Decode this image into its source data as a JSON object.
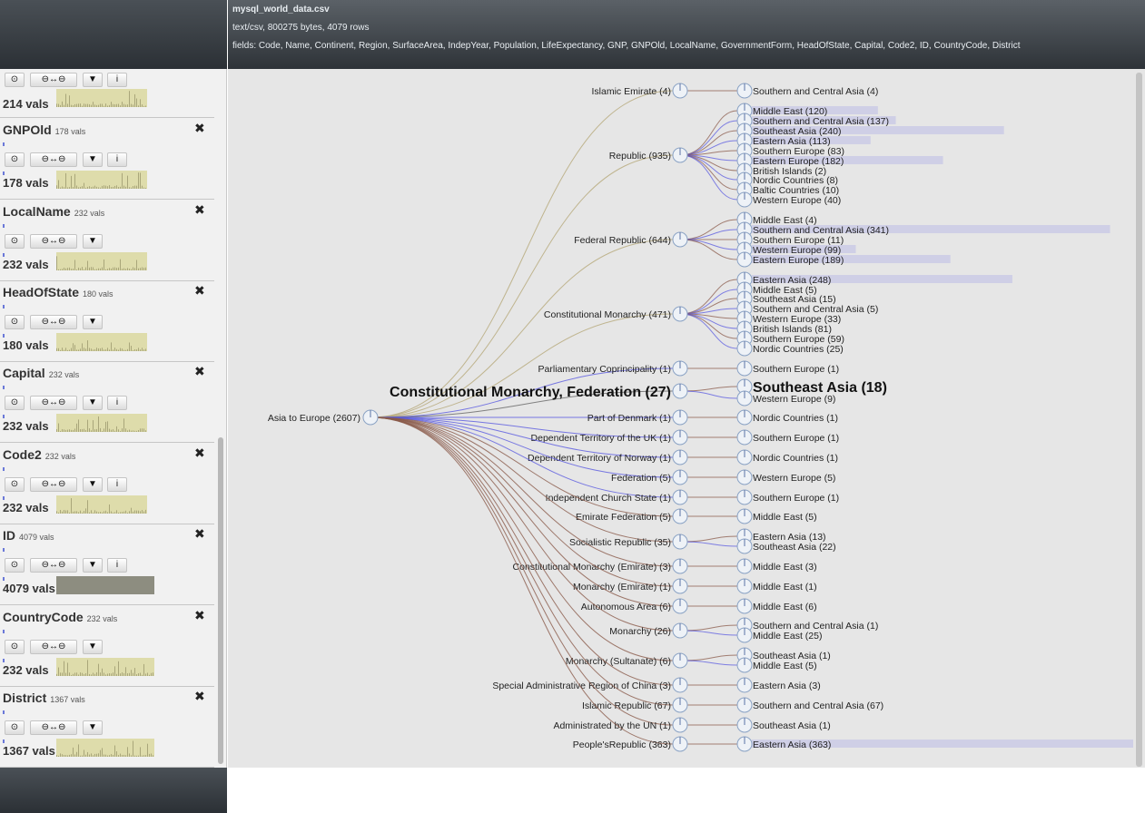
{
  "header": {
    "filename": "mysql_world_data.csv",
    "fileinfo": "text/csv, 800275 bytes, 4079 rows",
    "fields": "fields: Code, Name, Continent, Region, SurfaceArea, IndepYear, Population, LifeExpectancy, GNP, GNPOld, LocalName, GovernmentForm, HeadOfState, Capital, Code2, ID, CountryCode, District"
  },
  "toolbar": {
    "select": "⊙",
    "relate": "⊖↔⊖",
    "filter": "▼",
    "info": "i"
  },
  "sidebar": {
    "top_vals": "214 vals",
    "panels": [
      {
        "name": "GNPOld",
        "count": "178 vals",
        "vals": "178 vals",
        "info": true
      },
      {
        "name": "LocalName",
        "count": "232 vals",
        "vals": "232 vals",
        "info": false
      },
      {
        "name": "HeadOfState",
        "count": "180 vals",
        "vals": "180 vals",
        "info": false
      },
      {
        "name": "Capital",
        "count": "232 vals",
        "vals": "232 vals",
        "info": true
      },
      {
        "name": "Code2",
        "count": "232 vals",
        "vals": "232 vals",
        "info": true
      },
      {
        "name": "ID",
        "count": "4079 vals",
        "vals": "4079 vals",
        "info": true
      },
      {
        "name": "CountryCode",
        "count": "232 vals",
        "vals": "232 vals",
        "info": false
      },
      {
        "name": "District",
        "count": "1367 vals",
        "vals": "1367 vals",
        "info": false
      }
    ]
  },
  "colors": {
    "accent": "#6a78d8",
    "hist": "#dedcab",
    "link_brown": "#8a5a4a",
    "link_blue": "#5a5ae0",
    "bar": "#cfcfe6"
  },
  "tree": {
    "root": "Asia to Europe (2607)",
    "groups": [
      {
        "label": "Islamic Emirate (4)",
        "children": [
          {
            "t": "Southern and Central Asia (4)"
          }
        ]
      },
      {
        "label": "Republic (935)",
        "children": [
          {
            "t": "Middle East (120)",
            "v": 120
          },
          {
            "t": "Southern and Central Asia (137)",
            "v": 137
          },
          {
            "t": "Southeast Asia (240)",
            "v": 240
          },
          {
            "t": "Eastern Asia (113)",
            "v": 113
          },
          {
            "t": "Southern Europe (83)"
          },
          {
            "t": "Eastern Europe (182)",
            "v": 182
          },
          {
            "t": "British Islands (2)"
          },
          {
            "t": "Nordic Countries (8)"
          },
          {
            "t": "Baltic Countries (10)"
          },
          {
            "t": "Western Europe (40)"
          }
        ]
      },
      {
        "label": "Federal Republic (644)",
        "children": [
          {
            "t": "Middle East (4)"
          },
          {
            "t": "Southern and Central Asia (341)",
            "v": 341
          },
          {
            "t": "Southern Europe (11)"
          },
          {
            "t": "Western Europe (99)",
            "v": 99
          },
          {
            "t": "Eastern Europe (189)",
            "v": 189
          }
        ]
      },
      {
        "label": "Constitutional Monarchy (471)",
        "children": [
          {
            "t": "Eastern Asia (248)",
            "v": 248
          },
          {
            "t": "Middle East (5)"
          },
          {
            "t": "Southeast Asia (15)"
          },
          {
            "t": "Southern and Central Asia (5)"
          },
          {
            "t": "Western Europe (33)"
          },
          {
            "t": "British Islands (81)"
          },
          {
            "t": "Southern Europe (59)"
          },
          {
            "t": "Nordic Countries (25)"
          }
        ]
      },
      {
        "label": "Parliamentary Coprincipality (1)",
        "children": [
          {
            "t": "Southern Europe (1)"
          }
        ]
      },
      {
        "label": "Constitutional Monarchy, Federation (27)",
        "big": true,
        "children": [
          {
            "t": "Southeast Asia (18)",
            "big": true
          },
          {
            "t": "Western Europe (9)"
          }
        ]
      },
      {
        "label": "Part of Denmark (1)",
        "children": [
          {
            "t": "Nordic Countries (1)"
          }
        ]
      },
      {
        "label": "Dependent Territory of the UK (1)",
        "children": [
          {
            "t": "Southern Europe (1)"
          }
        ]
      },
      {
        "label": "Dependent Territory of Norway (1)",
        "children": [
          {
            "t": "Nordic Countries (1)"
          }
        ]
      },
      {
        "label": "Federation (5)",
        "children": [
          {
            "t": "Western Europe (5)"
          }
        ]
      },
      {
        "label": "Independent Church State (1)",
        "children": [
          {
            "t": "Southern Europe (1)"
          }
        ]
      },
      {
        "label": "Emirate Federation (5)",
        "children": [
          {
            "t": "Middle East (5)"
          }
        ]
      },
      {
        "label": "Socialistic Republic (35)",
        "children": [
          {
            "t": "Eastern Asia (13)"
          },
          {
            "t": "Southeast Asia (22)"
          }
        ]
      },
      {
        "label": "Constitutional Monarchy (Emirate) (3)",
        "children": [
          {
            "t": "Middle East (3)"
          }
        ]
      },
      {
        "label": "Monarchy (Emirate) (1)",
        "children": [
          {
            "t": "Middle East (1)"
          }
        ]
      },
      {
        "label": "Autonomous Area (6)",
        "children": [
          {
            "t": "Middle East (6)"
          }
        ]
      },
      {
        "label": "Monarchy (26)",
        "children": [
          {
            "t": "Southern and Central Asia (1)"
          },
          {
            "t": "Middle East (25)"
          }
        ]
      },
      {
        "label": "Monarchy (Sultanate) (6)",
        "children": [
          {
            "t": "Southeast Asia (1)"
          },
          {
            "t": "Middle East (5)"
          }
        ]
      },
      {
        "label": "Special Administrative Region of China (3)",
        "children": [
          {
            "t": "Eastern Asia (3)"
          }
        ]
      },
      {
        "label": "Islamic Republic (67)",
        "children": [
          {
            "t": "Southern and Central Asia (67)"
          }
        ]
      },
      {
        "label": "Administrated by the UN (1)",
        "children": [
          {
            "t": "Southeast Asia (1)"
          }
        ]
      },
      {
        "label": "People'sRepublic (363)",
        "children": [
          {
            "t": "Eastern Asia (363)",
            "v": 363
          }
        ]
      }
    ]
  }
}
